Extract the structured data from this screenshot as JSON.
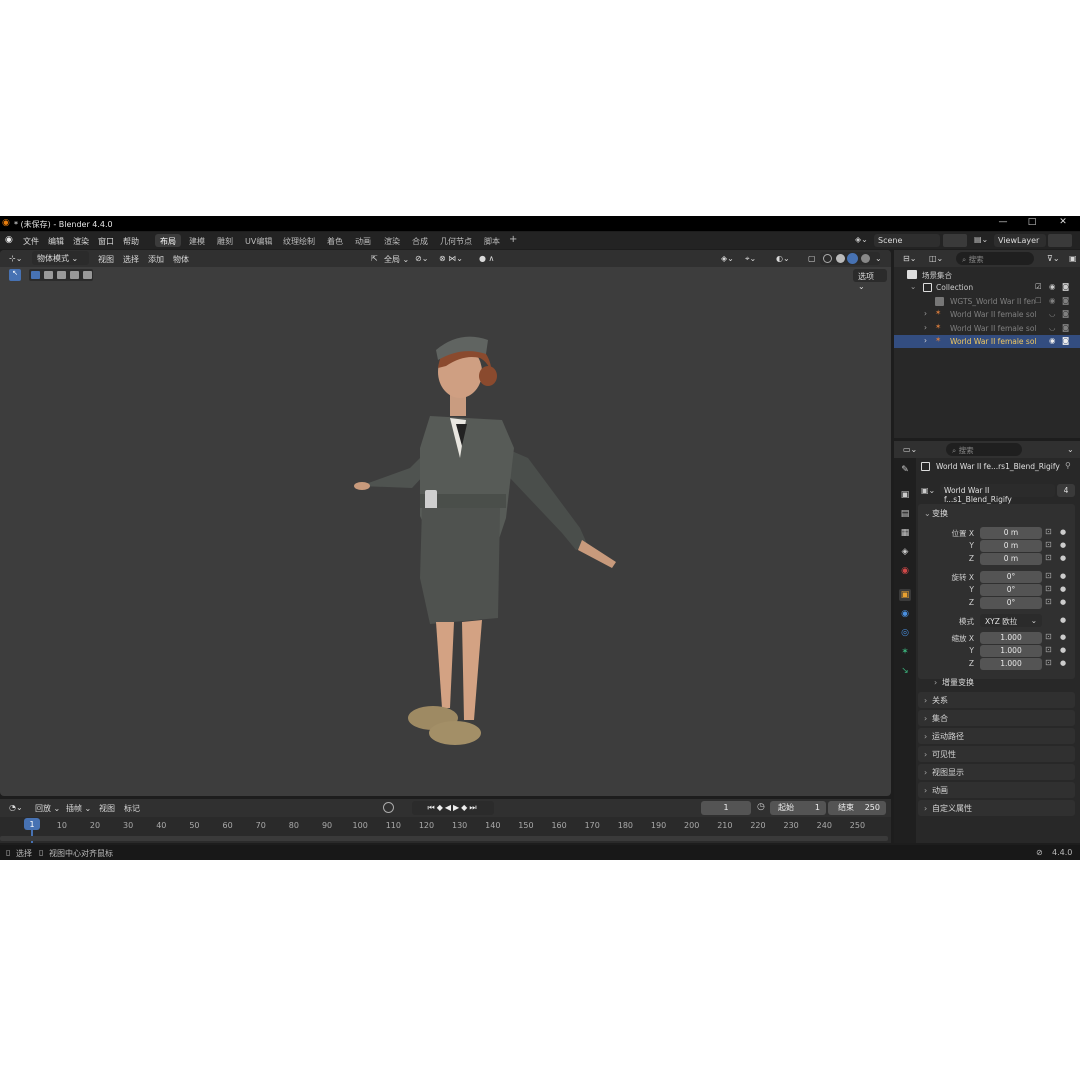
{
  "window": {
    "title": "* (未保存) - Blender 4.4.0",
    "minimize": "—",
    "maximize": "□",
    "close": "✕"
  },
  "menubar": {
    "menus": [
      "文件",
      "编辑",
      "渲染",
      "窗口",
      "帮助"
    ],
    "workspaces": [
      "布局",
      "建模",
      "雕刻",
      "UV编辑",
      "纹理绘制",
      "着色",
      "动画",
      "渲染",
      "合成",
      "几何节点",
      "脚本"
    ],
    "active_workspace": "布局",
    "add_workspace": "+",
    "scene": "Scene",
    "view_layer": "ViewLayer"
  },
  "viewport": {
    "mode": "物体模式",
    "menus": [
      "视图",
      "选择",
      "添加",
      "物体"
    ],
    "transform_orientation": "全局",
    "options_label": "选项"
  },
  "timeline": {
    "menus": [
      "回放",
      "插帧",
      "视图",
      "标记"
    ],
    "current_frame": "1",
    "start_label": "起始",
    "start_value": "1",
    "end_label": "结束",
    "end_value": "250",
    "ruler": [
      "1",
      "10",
      "20",
      "30",
      "40",
      "50",
      "60",
      "70",
      "80",
      "90",
      "100",
      "110",
      "120",
      "130",
      "140",
      "150",
      "160",
      "170",
      "180",
      "190",
      "200",
      "210",
      "220",
      "230",
      "240",
      "250"
    ]
  },
  "statusbar": {
    "select": "选择",
    "center_view": "视图中心对齐鼠标",
    "version": "4.4.0"
  },
  "outliner": {
    "search_placeholder": "搜索",
    "scene_collection": "场景集合",
    "collection": "Collection",
    "items": [
      "WGTS_World War II fen",
      "World War II female sol",
      "World War II female sol",
      "World War II female sol"
    ]
  },
  "properties": {
    "search_placeholder": "搜索",
    "object_name": "World War II fe...rs1_Blend_Rigify",
    "data_name": "World War II f...s1_Blend_Rigify",
    "users": "4",
    "transform_title": "变换",
    "location_label": "位置 X",
    "rotation_label": "旋转 X",
    "scale_label": "缩放 X",
    "axis_y": "Y",
    "axis_z": "Z",
    "location": [
      "0 m",
      "0 m",
      "0 m"
    ],
    "rotation": [
      "0°",
      "0°",
      "0°"
    ],
    "mode_label": "模式",
    "mode_value": "XYZ 欧拉",
    "scale": [
      "1.000",
      "1.000",
      "1.000"
    ],
    "delta_transform": "增量变换",
    "panels": [
      "关系",
      "集合",
      "运动路径",
      "可见性",
      "视图显示",
      "动画",
      "自定义属性"
    ]
  },
  "colors": {
    "accent": "#4772b3",
    "background": "#1d1d1d",
    "viewport": "#3d3d3d",
    "selected_row": "#334d80"
  }
}
